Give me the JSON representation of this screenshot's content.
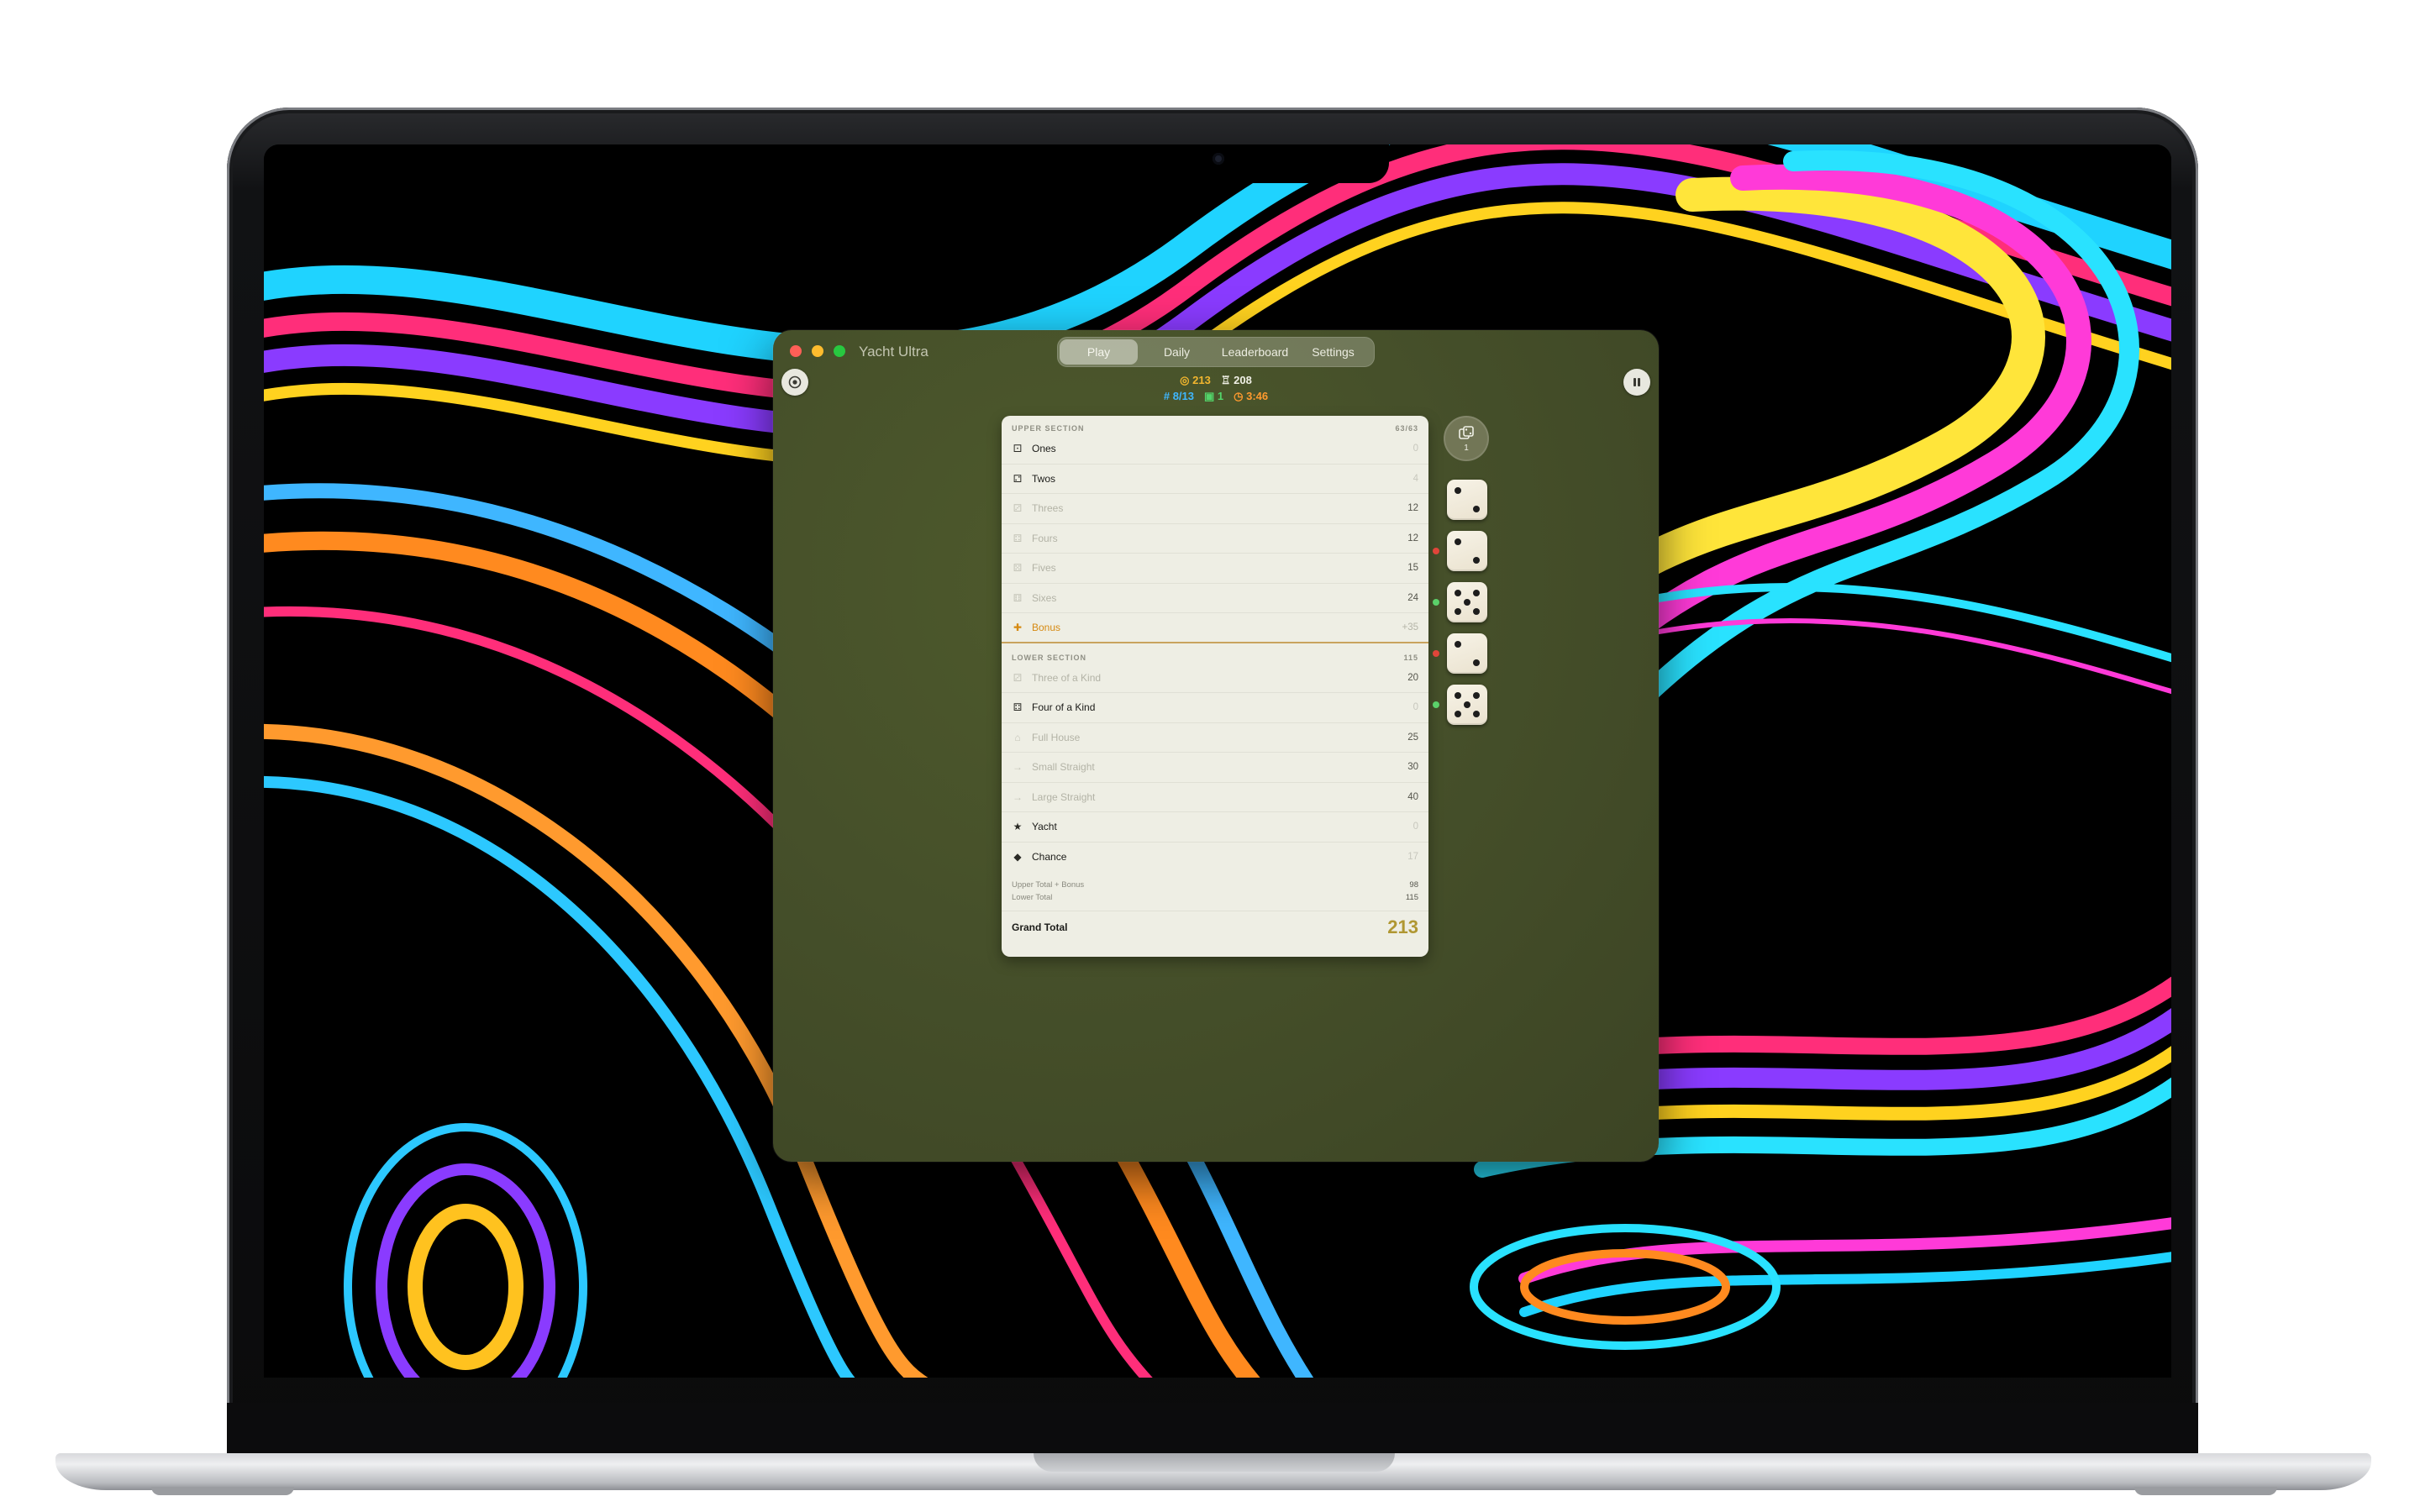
{
  "app": {
    "title": "Yacht Ultra",
    "tabs": [
      {
        "label": "Play",
        "active": true
      },
      {
        "label": "Daily",
        "active": false
      },
      {
        "label": "Leaderboard",
        "active": false
      },
      {
        "label": "Settings",
        "active": false
      }
    ]
  },
  "stats": {
    "score": "213",
    "best": "208",
    "turn": "8/13",
    "yachts": "1",
    "time": "3:46"
  },
  "scorecard": {
    "upper_title": "UPPER SECTION",
    "upper_progress": "63/63",
    "upper_rows": [
      {
        "name": "Ones",
        "value": "0",
        "icon": "die-one-icon",
        "state": "filled"
      },
      {
        "name": "Twos",
        "value": "4",
        "icon": "die-two-icon",
        "state": "filled"
      },
      {
        "name": "Threes",
        "value": "12",
        "icon": "die-three-icon",
        "state": "avail"
      },
      {
        "name": "Fours",
        "value": "12",
        "icon": "die-four-icon",
        "state": "avail"
      },
      {
        "name": "Fives",
        "value": "15",
        "icon": "die-five-icon",
        "state": "avail"
      },
      {
        "name": "Sixes",
        "value": "24",
        "icon": "die-six-icon",
        "state": "avail"
      }
    ],
    "bonus": {
      "name": "Bonus",
      "value": "+35",
      "icon": "gift-icon"
    },
    "lower_title": "LOWER SECTION",
    "lower_total_label": "115",
    "lower_rows": [
      {
        "name": "Three of a Kind",
        "value": "20",
        "icon": "three-of-a-kind-icon",
        "state": "avail"
      },
      {
        "name": "Four of a Kind",
        "value": "0",
        "icon": "four-of-a-kind-icon",
        "state": "filled"
      },
      {
        "name": "Full House",
        "value": "25",
        "icon": "house-icon",
        "state": "avail"
      },
      {
        "name": "Small Straight",
        "value": "30",
        "icon": "arrow-right-icon",
        "state": "avail"
      },
      {
        "name": "Large Straight",
        "value": "40",
        "icon": "arrow-right-icon",
        "state": "avail"
      },
      {
        "name": "Yacht",
        "value": "0",
        "icon": "star-icon",
        "state": "filled"
      },
      {
        "name": "Chance",
        "value": "17",
        "icon": "question-diamond-icon",
        "state": "filled"
      }
    ],
    "upper_total_label": "Upper Total + Bonus",
    "upper_total_value": "98",
    "lower_total_text": "Lower Total",
    "lower_total_value": "115",
    "grand_total_label": "Grand Total",
    "grand_total_value": "213"
  },
  "dice": {
    "rolls_left": "1",
    "values": [
      2,
      2,
      5,
      2,
      5
    ],
    "markers": [
      "none",
      "red",
      "green",
      "red",
      "green"
    ]
  },
  "colors": {
    "window_bg": "#46502a",
    "accent_gold": "#f2b62e",
    "bonus_orange": "#d68a12",
    "grand_total": "#b09732"
  }
}
